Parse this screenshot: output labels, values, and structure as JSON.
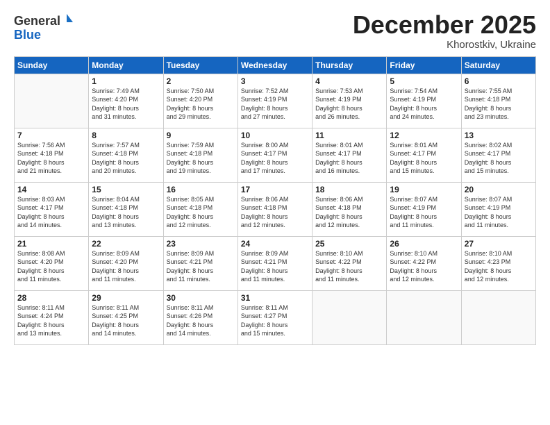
{
  "logo": {
    "line1": "General",
    "line2": "Blue"
  },
  "title": "December 2025",
  "subtitle": "Khorostkiv, Ukraine",
  "header_days": [
    "Sunday",
    "Monday",
    "Tuesday",
    "Wednesday",
    "Thursday",
    "Friday",
    "Saturday"
  ],
  "weeks": [
    [
      {
        "day": "",
        "info": ""
      },
      {
        "day": "1",
        "info": "Sunrise: 7:49 AM\nSunset: 4:20 PM\nDaylight: 8 hours\nand 31 minutes."
      },
      {
        "day": "2",
        "info": "Sunrise: 7:50 AM\nSunset: 4:20 PM\nDaylight: 8 hours\nand 29 minutes."
      },
      {
        "day": "3",
        "info": "Sunrise: 7:52 AM\nSunset: 4:19 PM\nDaylight: 8 hours\nand 27 minutes."
      },
      {
        "day": "4",
        "info": "Sunrise: 7:53 AM\nSunset: 4:19 PM\nDaylight: 8 hours\nand 26 minutes."
      },
      {
        "day": "5",
        "info": "Sunrise: 7:54 AM\nSunset: 4:19 PM\nDaylight: 8 hours\nand 24 minutes."
      },
      {
        "day": "6",
        "info": "Sunrise: 7:55 AM\nSunset: 4:18 PM\nDaylight: 8 hours\nand 23 minutes."
      }
    ],
    [
      {
        "day": "7",
        "info": "Sunrise: 7:56 AM\nSunset: 4:18 PM\nDaylight: 8 hours\nand 21 minutes."
      },
      {
        "day": "8",
        "info": "Sunrise: 7:57 AM\nSunset: 4:18 PM\nDaylight: 8 hours\nand 20 minutes."
      },
      {
        "day": "9",
        "info": "Sunrise: 7:59 AM\nSunset: 4:18 PM\nDaylight: 8 hours\nand 19 minutes."
      },
      {
        "day": "10",
        "info": "Sunrise: 8:00 AM\nSunset: 4:17 PM\nDaylight: 8 hours\nand 17 minutes."
      },
      {
        "day": "11",
        "info": "Sunrise: 8:01 AM\nSunset: 4:17 PM\nDaylight: 8 hours\nand 16 minutes."
      },
      {
        "day": "12",
        "info": "Sunrise: 8:01 AM\nSunset: 4:17 PM\nDaylight: 8 hours\nand 15 minutes."
      },
      {
        "day": "13",
        "info": "Sunrise: 8:02 AM\nSunset: 4:17 PM\nDaylight: 8 hours\nand 15 minutes."
      }
    ],
    [
      {
        "day": "14",
        "info": "Sunrise: 8:03 AM\nSunset: 4:17 PM\nDaylight: 8 hours\nand 14 minutes."
      },
      {
        "day": "15",
        "info": "Sunrise: 8:04 AM\nSunset: 4:18 PM\nDaylight: 8 hours\nand 13 minutes."
      },
      {
        "day": "16",
        "info": "Sunrise: 8:05 AM\nSunset: 4:18 PM\nDaylight: 8 hours\nand 12 minutes."
      },
      {
        "day": "17",
        "info": "Sunrise: 8:06 AM\nSunset: 4:18 PM\nDaylight: 8 hours\nand 12 minutes."
      },
      {
        "day": "18",
        "info": "Sunrise: 8:06 AM\nSunset: 4:18 PM\nDaylight: 8 hours\nand 12 minutes."
      },
      {
        "day": "19",
        "info": "Sunrise: 8:07 AM\nSunset: 4:19 PM\nDaylight: 8 hours\nand 11 minutes."
      },
      {
        "day": "20",
        "info": "Sunrise: 8:07 AM\nSunset: 4:19 PM\nDaylight: 8 hours\nand 11 minutes."
      }
    ],
    [
      {
        "day": "21",
        "info": "Sunrise: 8:08 AM\nSunset: 4:20 PM\nDaylight: 8 hours\nand 11 minutes."
      },
      {
        "day": "22",
        "info": "Sunrise: 8:09 AM\nSunset: 4:20 PM\nDaylight: 8 hours\nand 11 minutes."
      },
      {
        "day": "23",
        "info": "Sunrise: 8:09 AM\nSunset: 4:21 PM\nDaylight: 8 hours\nand 11 minutes."
      },
      {
        "day": "24",
        "info": "Sunrise: 8:09 AM\nSunset: 4:21 PM\nDaylight: 8 hours\nand 11 minutes."
      },
      {
        "day": "25",
        "info": "Sunrise: 8:10 AM\nSunset: 4:22 PM\nDaylight: 8 hours\nand 11 minutes."
      },
      {
        "day": "26",
        "info": "Sunrise: 8:10 AM\nSunset: 4:22 PM\nDaylight: 8 hours\nand 12 minutes."
      },
      {
        "day": "27",
        "info": "Sunrise: 8:10 AM\nSunset: 4:23 PM\nDaylight: 8 hours\nand 12 minutes."
      }
    ],
    [
      {
        "day": "28",
        "info": "Sunrise: 8:11 AM\nSunset: 4:24 PM\nDaylight: 8 hours\nand 13 minutes."
      },
      {
        "day": "29",
        "info": "Sunrise: 8:11 AM\nSunset: 4:25 PM\nDaylight: 8 hours\nand 14 minutes."
      },
      {
        "day": "30",
        "info": "Sunrise: 8:11 AM\nSunset: 4:26 PM\nDaylight: 8 hours\nand 14 minutes."
      },
      {
        "day": "31",
        "info": "Sunrise: 8:11 AM\nSunset: 4:27 PM\nDaylight: 8 hours\nand 15 minutes."
      },
      {
        "day": "",
        "info": ""
      },
      {
        "day": "",
        "info": ""
      },
      {
        "day": "",
        "info": ""
      }
    ]
  ]
}
